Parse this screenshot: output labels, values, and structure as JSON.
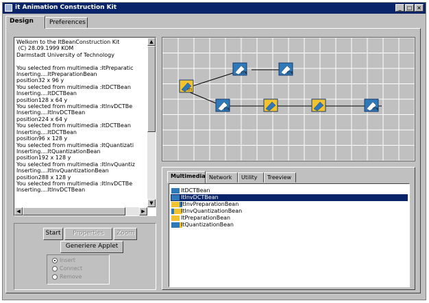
{
  "window": {
    "title": "it Animation Construction Kit",
    "controls": [
      "_",
      "□",
      "×"
    ]
  },
  "tabs": [
    "Design",
    "Preferences"
  ],
  "log": {
    "lines": [
      "Welkom to the ItBeanConstruction Kit",
      " (C) 28.09.1999 KOM",
      "Darmstadt University of Technology",
      "",
      "You selected from multimedia :ItPreparatic",
      "Inserting....ItPreparationBean",
      "position32 x 96 y",
      "You selected from multimedia :ItDCTBean",
      "Inserting....ItDCTBean",
      "position128 x 64 y",
      "You selected from multimedia :ItInvDCTBe",
      "Inserting....ItInvDCTBean",
      "position224 x 64 y",
      "You selected from multimedia :ItDCTBean",
      "Inserting....ItDCTBean",
      "position96 x 128 y",
      "You selected from multimedia :ItQuantizati",
      "Inserting....ItQuantizationBean",
      "position192 x 128 y",
      "You selected from multimedia :ItInvQuantiz",
      "Inserting....ItInvQuantizationBean",
      "position288 x 128 y",
      "You selected from multimedia :ItInvDCTBe",
      "Inserting....ItInvDCTBean"
    ]
  },
  "controls": {
    "start": "Start",
    "properties": "Properties",
    "zoom": "Zoom",
    "generate": "Generiere Applet",
    "modes": [
      "Insert",
      "Connect",
      "Remove"
    ],
    "selected_mode": "Insert"
  },
  "palette": {
    "tabs": [
      "Multimedia",
      "Network",
      "Utility",
      "Treeview"
    ],
    "items": [
      "ItDCTBean",
      "ItInvDCTBean",
      "ItInvPreparationBean",
      "ItInvQuantizationBean",
      "ItPreparationBean",
      "ItQuantizationBean"
    ],
    "selected": "ItInvDCTBean"
  },
  "canvas": {
    "beans": [
      {
        "label": "ITI",
        "kind": "preparation"
      },
      {
        "label": "ITN",
        "kind": "dct"
      },
      {
        "label": "ITN",
        "kind": "inv-dct"
      },
      {
        "label": "ITN",
        "kind": "dct"
      },
      {
        "label": "",
        "kind": "quantization"
      },
      {
        "label": "",
        "kind": "inv-quantization"
      },
      {
        "label": "ITN",
        "kind": "inv-dct"
      }
    ]
  },
  "colors": {
    "titlebar": "#0a246a",
    "selection": "#0a246a",
    "bean_blue": "#2f79b8",
    "bean_yellow": "#f1c232"
  }
}
